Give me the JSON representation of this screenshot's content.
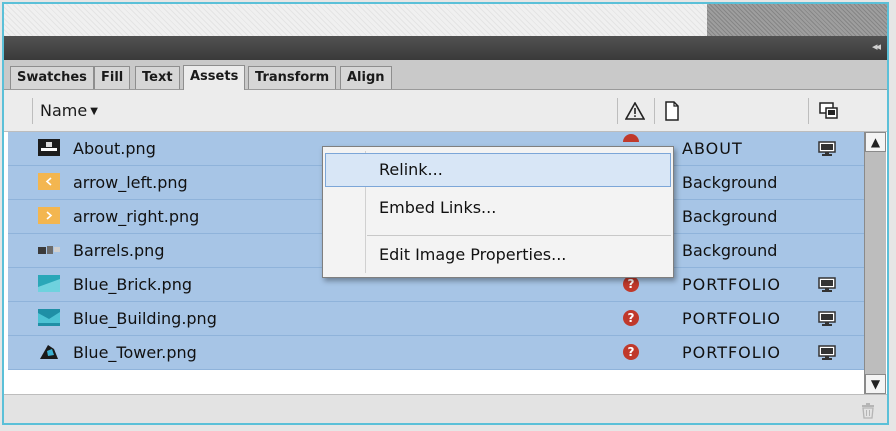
{
  "panel": {
    "collapse_label": "◂◂",
    "tabs": [
      {
        "label": "Swatches",
        "active": false
      },
      {
        "label": "Fill",
        "active": false
      },
      {
        "label": "Text",
        "active": false
      },
      {
        "label": "Assets",
        "active": true
      },
      {
        "label": "Transform",
        "active": false
      },
      {
        "label": "Align",
        "active": false
      }
    ]
  },
  "columns": {
    "name": "Name",
    "name_sort_icon": "caret-down-icon",
    "status_icon": "warning-triangle-icon",
    "page_icon": "page-icon",
    "preview_icon": "device-preview-icon"
  },
  "assets": [
    {
      "name": "About.png",
      "missing": true,
      "page": "ABOUT",
      "monitor": true,
      "thumb": "dark-photo"
    },
    {
      "name": "arrow_left.png",
      "missing": false,
      "page": "Background",
      "monitor": false,
      "thumb": "orange-arrow-left"
    },
    {
      "name": "arrow_right.png",
      "missing": false,
      "page": "Background",
      "monitor": false,
      "thumb": "orange-arrow-right"
    },
    {
      "name": "Barrels.png",
      "missing": false,
      "page": "Background",
      "monitor": false,
      "thumb": "barrels-photo"
    },
    {
      "name": "Blue_Brick.png",
      "missing": true,
      "page": "PORTFOLIO",
      "monitor": true,
      "thumb": "blue-brick-photo"
    },
    {
      "name": "Blue_Building.png",
      "missing": true,
      "page": "PORTFOLIO",
      "monitor": true,
      "thumb": "blue-building-photo"
    },
    {
      "name": "Blue_Tower.png",
      "missing": true,
      "page": "PORTFOLIO",
      "monitor": true,
      "thumb": "blue-tower-photo"
    }
  ],
  "status_glyph": "?",
  "context_menu": {
    "items": [
      "Relink...",
      "Embed Links...",
      "Edit Image Properties..."
    ],
    "highlighted": "Relink..."
  },
  "footer": {
    "trash_icon": "trash-icon"
  },
  "scrollbar": {
    "up": "▲",
    "down": "▼"
  },
  "colors": {
    "selection_row": "#a7c5e6",
    "accent_border": "#5bc0d8",
    "warning": "#c0392b",
    "menu_highlight": "#d8e6f6"
  }
}
